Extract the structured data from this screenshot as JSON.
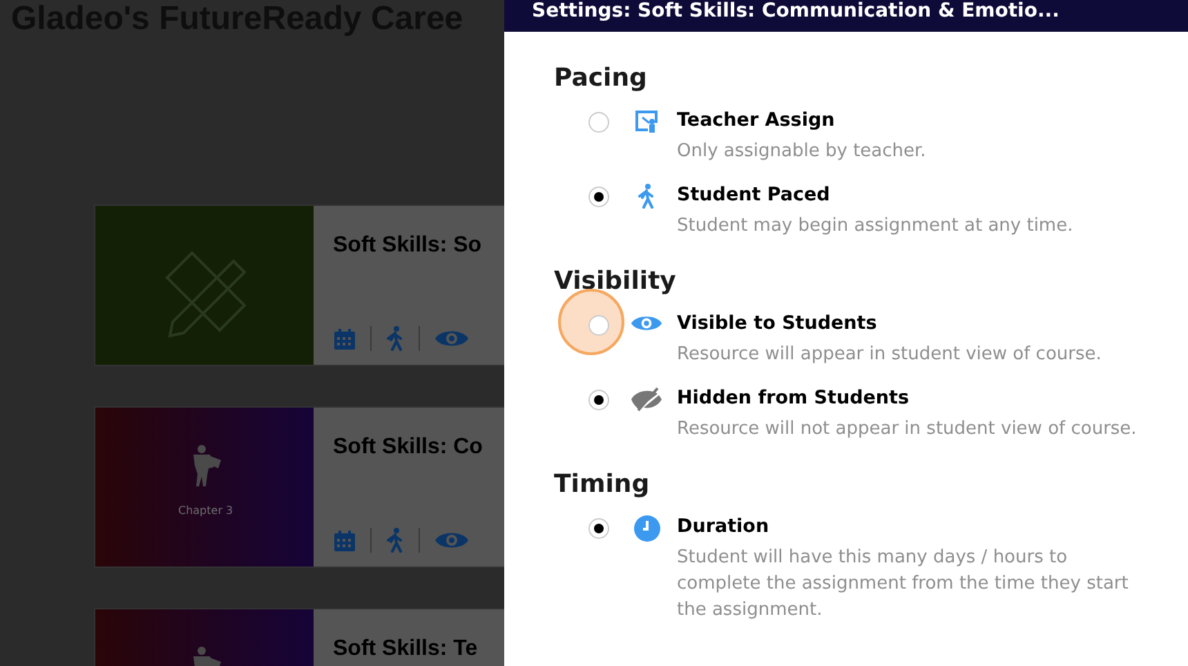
{
  "page_title": "Gladeo's FutureReady Caree",
  "courses": [
    {
      "title": "Soft Skills: So",
      "kind": "tools",
      "icons": [
        {
          "kind": "calendar"
        },
        {
          "kind": "walk"
        },
        {
          "kind": "eye"
        }
      ]
    },
    {
      "title": "Soft Skills: Co",
      "kind": "hero",
      "caption": "Chapter 3",
      "icons": [
        {
          "kind": "calendar"
        },
        {
          "kind": "walk"
        },
        {
          "kind": "eye"
        }
      ]
    },
    {
      "title": "Soft Skills: Te",
      "kind": "hero"
    }
  ],
  "settings": {
    "title": "Settings: Soft Skills: Communication & Emotio...",
    "sections": [
      {
        "heading": "Pacing",
        "options": [
          {
            "kind": "teacher",
            "label": "Teacher Assign",
            "description": "Only assignable by teacher.",
            "selected": false,
            "clicked": false
          },
          {
            "kind": "walk",
            "label": "Student Paced",
            "description": "Student may begin assignment at any time.",
            "selected": true,
            "clicked": false
          }
        ]
      },
      {
        "heading": "Visibility",
        "options": [
          {
            "kind": "eye",
            "label": "Visible to Students",
            "description": "Resource will appear in student view of course.",
            "selected": false,
            "clicked": true
          },
          {
            "kind": "eye-off",
            "label": "Hidden from Students",
            "description": "Resource will not appear in student view of course.",
            "selected": true,
            "clicked": false
          }
        ]
      },
      {
        "heading": "Timing",
        "options": [
          {
            "kind": "clock",
            "label": "Duration",
            "description": "Student will have this many days / hours to complete the assignment from the time they start the assignment.",
            "selected": true,
            "clicked": false
          }
        ]
      }
    ]
  }
}
